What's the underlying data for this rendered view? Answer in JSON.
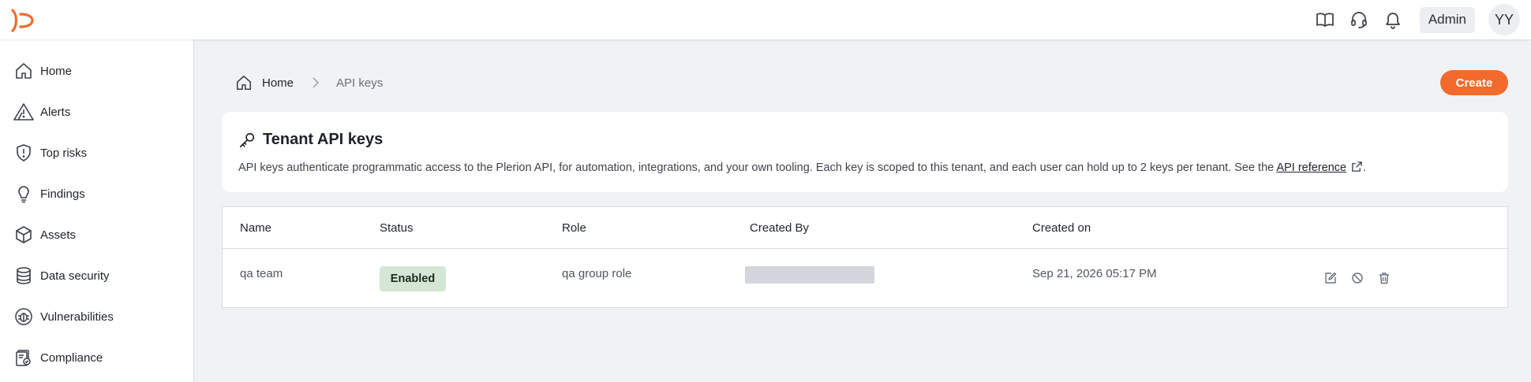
{
  "header": {
    "icons": [
      "book-icon",
      "headset-icon",
      "bell-icon"
    ],
    "admin_label": "Admin",
    "avatar_initials": "YY"
  },
  "sidebar": {
    "items": [
      {
        "label": "Home",
        "icon": "home-icon"
      },
      {
        "label": "Alerts",
        "icon": "alert-triangle-icon"
      },
      {
        "label": "Top risks",
        "icon": "shield-alert-icon"
      },
      {
        "label": "Findings",
        "icon": "lightbulb-icon"
      },
      {
        "label": "Assets",
        "icon": "cube-icon"
      },
      {
        "label": "Data security",
        "icon": "database-icon"
      },
      {
        "label": "Vulnerabilities",
        "icon": "bug-icon"
      },
      {
        "label": "Compliance",
        "icon": "compliance-icon"
      }
    ]
  },
  "breadcrumb": {
    "home": "Home",
    "current": "API keys"
  },
  "actions": {
    "create_label": "Create"
  },
  "card": {
    "title": "Tenant API keys",
    "description": "API keys authenticate programmatic access to the Plerion API, for automation, integrations, and your own tooling. Each key is scoped to this tenant, and each user can hold up to 2 keys per tenant. See the",
    "link_text": "API reference",
    "trailing": "."
  },
  "table": {
    "columns": [
      "Name",
      "Status",
      "Role",
      "Created By",
      "Created on"
    ],
    "rows": [
      {
        "name": "qa team",
        "status": "Enabled",
        "role": "qa group role",
        "created_by": "",
        "created_on": "Sep 21, 2026 05:17 PM",
        "actions": [
          "edit-icon",
          "disable-icon",
          "delete-icon"
        ]
      }
    ]
  },
  "colors": {
    "accent": "#f26b2c",
    "enabled_badge": "#d4e7d5",
    "page_background": "#f1f2f4"
  }
}
